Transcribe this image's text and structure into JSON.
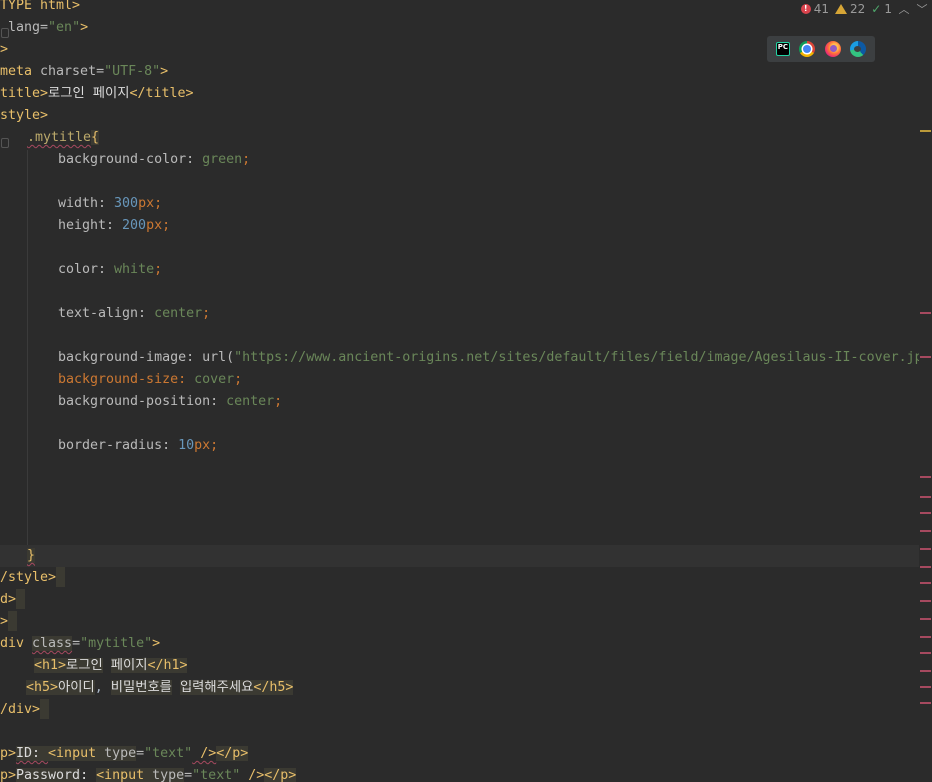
{
  "inspections": {
    "errors": "41",
    "warnings": "22",
    "weak": "1",
    "colors": {
      "error": "#d9434d",
      "warning": "#d6a536",
      "ok": "#4fa86c"
    }
  },
  "browsers": [
    "pycharm-icon",
    "chrome-icon",
    "firefox-icon",
    "edge-icon"
  ],
  "pc_label": "PC",
  "code": {
    "l1a": "TYPE html>",
    "l2a": " lang=",
    "l2b": "\"en\"",
    "l2c": ">",
    "l3a": ">",
    "l4a": "meta ",
    "l4b": "charset=",
    "l4c": "\"UTF-8\"",
    "l4d": ">",
    "l5a": "title>",
    "l5b": "로그인 페이지",
    "l5c": "</title>",
    "l6a": "style>",
    "l7a": ".mytitle",
    "l7b": "{",
    "l8a": "background-color: ",
    "l8b": "green",
    "l8c": ";",
    "l10a": "width: ",
    "l10b": "300",
    "l10c": "px;",
    "l11a": "height: ",
    "l11b": "200",
    "l11c": "px;",
    "l13a": "color: ",
    "l13b": "white",
    "l13c": ";",
    "l15a": "text-align: ",
    "l15b": "center",
    "l15c": ";",
    "l17a": "background-image: ",
    "l17b": "url(",
    "l17c": "\"https://www.ancient-origins.net/sites/default/files/field/image/Agesilaus-II-cover.jpg",
    "l18a": "background-size: ",
    "l18b": "cover",
    "l18c": ";",
    "l19a": "background-position: ",
    "l19b": "center",
    "l19c": ";",
    "l21a": "border-radius: ",
    "l21b": "10",
    "l21c": "px;",
    "l26a": "}",
    "l27a": "/style>",
    "l28a": "d>",
    "l29a": ">",
    "l30a": "div ",
    "l30b": "class",
    "l30c": "=",
    "l30d": "\"mytitle\"",
    "l30e": ">",
    "l31a": "<h1>",
    "l31b": "로그인",
    "l31c": " ",
    "l31d": "페이지",
    "l31e": "</h1>",
    "l32a": "<h5>",
    "l32b": "아이디",
    "l32c": ", ",
    "l32d": "비밀번호를",
    "l32e": " ",
    "l32f": "입력해주세요",
    "l32g": "</h5>",
    "l33a": "/div>",
    "l35a": "p>",
    "l35b": "ID: ",
    "l35c": "<input ",
    "l35d": "type",
    "l35e": "=",
    "l35f": "\"text\"",
    "l35g": " />",
    "l35h": "</p>",
    "l36a": "p>",
    "l36b": "Password",
    "l36c": ": ",
    "l36d": "<input ",
    "l36e": "type",
    "l36f": "=",
    "l36g": "\"text\"",
    "l36h": " />",
    "l36i": "</p>"
  }
}
